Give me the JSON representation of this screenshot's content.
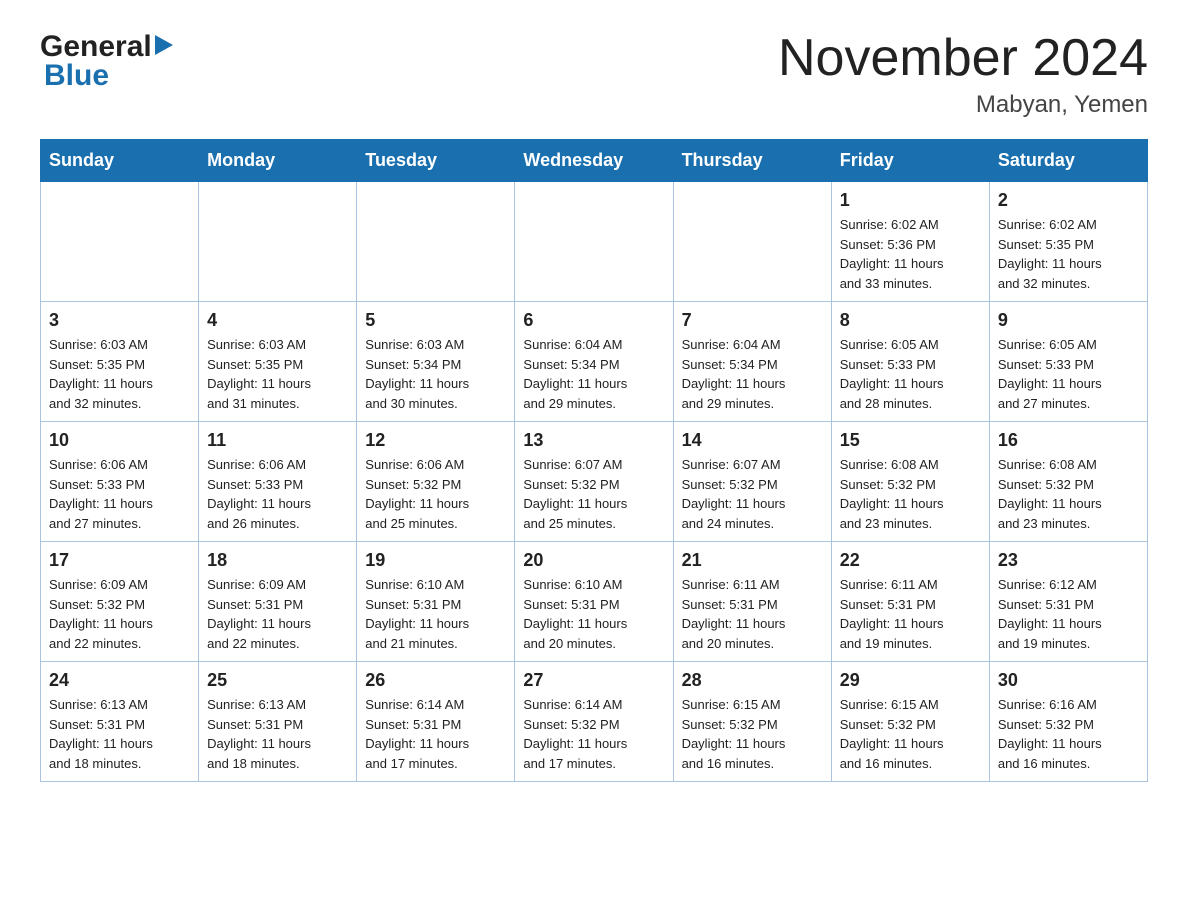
{
  "header": {
    "month_title": "November 2024",
    "location": "Mabyan, Yemen",
    "logo_general": "General",
    "logo_blue": "Blue"
  },
  "days_of_week": [
    "Sunday",
    "Monday",
    "Tuesday",
    "Wednesday",
    "Thursday",
    "Friday",
    "Saturday"
  ],
  "weeks": [
    [
      {
        "day": "",
        "info": ""
      },
      {
        "day": "",
        "info": ""
      },
      {
        "day": "",
        "info": ""
      },
      {
        "day": "",
        "info": ""
      },
      {
        "day": "",
        "info": ""
      },
      {
        "day": "1",
        "info": "Sunrise: 6:02 AM\nSunset: 5:36 PM\nDaylight: 11 hours\nand 33 minutes."
      },
      {
        "day": "2",
        "info": "Sunrise: 6:02 AM\nSunset: 5:35 PM\nDaylight: 11 hours\nand 32 minutes."
      }
    ],
    [
      {
        "day": "3",
        "info": "Sunrise: 6:03 AM\nSunset: 5:35 PM\nDaylight: 11 hours\nand 32 minutes."
      },
      {
        "day": "4",
        "info": "Sunrise: 6:03 AM\nSunset: 5:35 PM\nDaylight: 11 hours\nand 31 minutes."
      },
      {
        "day": "5",
        "info": "Sunrise: 6:03 AM\nSunset: 5:34 PM\nDaylight: 11 hours\nand 30 minutes."
      },
      {
        "day": "6",
        "info": "Sunrise: 6:04 AM\nSunset: 5:34 PM\nDaylight: 11 hours\nand 29 minutes."
      },
      {
        "day": "7",
        "info": "Sunrise: 6:04 AM\nSunset: 5:34 PM\nDaylight: 11 hours\nand 29 minutes."
      },
      {
        "day": "8",
        "info": "Sunrise: 6:05 AM\nSunset: 5:33 PM\nDaylight: 11 hours\nand 28 minutes."
      },
      {
        "day": "9",
        "info": "Sunrise: 6:05 AM\nSunset: 5:33 PM\nDaylight: 11 hours\nand 27 minutes."
      }
    ],
    [
      {
        "day": "10",
        "info": "Sunrise: 6:06 AM\nSunset: 5:33 PM\nDaylight: 11 hours\nand 27 minutes."
      },
      {
        "day": "11",
        "info": "Sunrise: 6:06 AM\nSunset: 5:33 PM\nDaylight: 11 hours\nand 26 minutes."
      },
      {
        "day": "12",
        "info": "Sunrise: 6:06 AM\nSunset: 5:32 PM\nDaylight: 11 hours\nand 25 minutes."
      },
      {
        "day": "13",
        "info": "Sunrise: 6:07 AM\nSunset: 5:32 PM\nDaylight: 11 hours\nand 25 minutes."
      },
      {
        "day": "14",
        "info": "Sunrise: 6:07 AM\nSunset: 5:32 PM\nDaylight: 11 hours\nand 24 minutes."
      },
      {
        "day": "15",
        "info": "Sunrise: 6:08 AM\nSunset: 5:32 PM\nDaylight: 11 hours\nand 23 minutes."
      },
      {
        "day": "16",
        "info": "Sunrise: 6:08 AM\nSunset: 5:32 PM\nDaylight: 11 hours\nand 23 minutes."
      }
    ],
    [
      {
        "day": "17",
        "info": "Sunrise: 6:09 AM\nSunset: 5:32 PM\nDaylight: 11 hours\nand 22 minutes."
      },
      {
        "day": "18",
        "info": "Sunrise: 6:09 AM\nSunset: 5:31 PM\nDaylight: 11 hours\nand 22 minutes."
      },
      {
        "day": "19",
        "info": "Sunrise: 6:10 AM\nSunset: 5:31 PM\nDaylight: 11 hours\nand 21 minutes."
      },
      {
        "day": "20",
        "info": "Sunrise: 6:10 AM\nSunset: 5:31 PM\nDaylight: 11 hours\nand 20 minutes."
      },
      {
        "day": "21",
        "info": "Sunrise: 6:11 AM\nSunset: 5:31 PM\nDaylight: 11 hours\nand 20 minutes."
      },
      {
        "day": "22",
        "info": "Sunrise: 6:11 AM\nSunset: 5:31 PM\nDaylight: 11 hours\nand 19 minutes."
      },
      {
        "day": "23",
        "info": "Sunrise: 6:12 AM\nSunset: 5:31 PM\nDaylight: 11 hours\nand 19 minutes."
      }
    ],
    [
      {
        "day": "24",
        "info": "Sunrise: 6:13 AM\nSunset: 5:31 PM\nDaylight: 11 hours\nand 18 minutes."
      },
      {
        "day": "25",
        "info": "Sunrise: 6:13 AM\nSunset: 5:31 PM\nDaylight: 11 hours\nand 18 minutes."
      },
      {
        "day": "26",
        "info": "Sunrise: 6:14 AM\nSunset: 5:31 PM\nDaylight: 11 hours\nand 17 minutes."
      },
      {
        "day": "27",
        "info": "Sunrise: 6:14 AM\nSunset: 5:32 PM\nDaylight: 11 hours\nand 17 minutes."
      },
      {
        "day": "28",
        "info": "Sunrise: 6:15 AM\nSunset: 5:32 PM\nDaylight: 11 hours\nand 16 minutes."
      },
      {
        "day": "29",
        "info": "Sunrise: 6:15 AM\nSunset: 5:32 PM\nDaylight: 11 hours\nand 16 minutes."
      },
      {
        "day": "30",
        "info": "Sunrise: 6:16 AM\nSunset: 5:32 PM\nDaylight: 11 hours\nand 16 minutes."
      }
    ]
  ]
}
